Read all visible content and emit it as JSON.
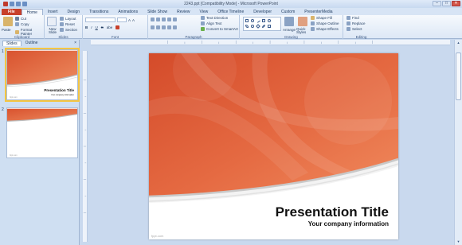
{
  "window": {
    "title": "2243.ppt [Compatibility Mode] - Microsoft PowerPoint",
    "controls": [
      "–",
      "□",
      "✕"
    ]
  },
  "tabs": [
    {
      "label": "File"
    },
    {
      "label": "Home"
    },
    {
      "label": "Insert"
    },
    {
      "label": "Design"
    },
    {
      "label": "Transitions"
    },
    {
      "label": "Animations"
    },
    {
      "label": "Slide Show"
    },
    {
      "label": "Review"
    },
    {
      "label": "View"
    },
    {
      "label": "Office Timeline"
    },
    {
      "label": "Developer"
    },
    {
      "label": "Custom"
    },
    {
      "label": "PresenterMedia"
    }
  ],
  "ribbon": {
    "clipboard": {
      "label": "Clipboard",
      "paste": "Paste",
      "cut": "Cut",
      "copy": "Copy",
      "format_painter": "Format Painter"
    },
    "slides": {
      "label": "Slides",
      "new_slide": "New Slide",
      "layout": "Layout",
      "reset": "Reset",
      "section": "Section"
    },
    "font": {
      "label": "Font",
      "bold": "B",
      "italic": "I",
      "underline": "U",
      "strike": "S",
      "shadow": "abe",
      "size_up": "A",
      "size_down": "A"
    },
    "paragraph": {
      "label": "Paragraph",
      "text_direction": "Text Direction",
      "align_text": "Align Text",
      "smartart": "Convert to SmartArt"
    },
    "drawing": {
      "label": "Drawing",
      "arrange": "Arrange",
      "quick_styles": "Quick Styles",
      "shape_fill": "Shape Fill",
      "shape_outline": "Shape Outline",
      "shape_effects": "Shape Effects"
    },
    "editing": {
      "label": "Editing",
      "find": "Find",
      "replace": "Replace",
      "select": "Select"
    }
  },
  "panel": {
    "tabs": [
      "Slides",
      "Outline"
    ],
    "close": "×",
    "slides": [
      {
        "number": "1",
        "title": "Presentation Title",
        "subtitle": "Your company information",
        "footer": "fppt.com"
      },
      {
        "number": "2",
        "footer": "fppt.com"
      }
    ]
  },
  "slide": {
    "title": "Presentation Title",
    "subtitle": "Your company information",
    "footer": "fppt.com"
  },
  "colors": {
    "accent": "#c8402a",
    "slide_orange": "#e0653f",
    "slide_orange_dark": "#c6402a"
  }
}
